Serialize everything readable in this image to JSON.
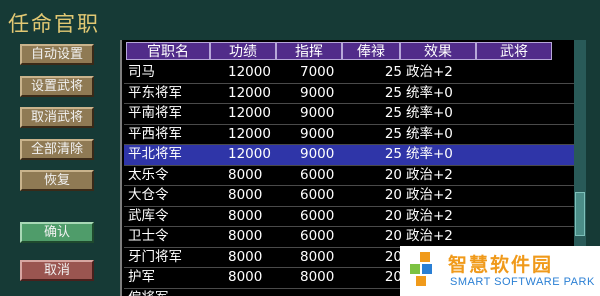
{
  "window": {
    "title": "任命官职"
  },
  "buttons": {
    "auto_set": "自动设置",
    "set_general": "设置武将",
    "cancel_general": "取消武将",
    "clear_all": "全部清除",
    "restore": "恢复",
    "confirm": "确认",
    "cancel": "取消"
  },
  "table": {
    "headers": [
      "官职名",
      "功绩",
      "指挥",
      "俸禄",
      "效果",
      "武将"
    ],
    "rows": [
      {
        "name": "司马",
        "merit": "12000",
        "command": "7000",
        "salary": "25",
        "effect": "政治+2",
        "general": "",
        "selected": false
      },
      {
        "name": "平东将军",
        "merit": "12000",
        "command": "9000",
        "salary": "25",
        "effect": "统率+0",
        "general": "",
        "selected": false
      },
      {
        "name": "平南将军",
        "merit": "12000",
        "command": "9000",
        "salary": "25",
        "effect": "统率+0",
        "general": "",
        "selected": false
      },
      {
        "name": "平西将军",
        "merit": "12000",
        "command": "9000",
        "salary": "25",
        "effect": "统率+0",
        "general": "",
        "selected": false
      },
      {
        "name": "平北将军",
        "merit": "12000",
        "command": "9000",
        "salary": "25",
        "effect": "统率+0",
        "general": "",
        "selected": true
      },
      {
        "name": "太乐令",
        "merit": "8000",
        "command": "6000",
        "salary": "20",
        "effect": "政治+2",
        "general": "",
        "selected": false
      },
      {
        "name": "大仓令",
        "merit": "8000",
        "command": "6000",
        "salary": "20",
        "effect": "政治+2",
        "general": "",
        "selected": false
      },
      {
        "name": "武库令",
        "merit": "8000",
        "command": "6000",
        "salary": "20",
        "effect": "政治+2",
        "general": "",
        "selected": false
      },
      {
        "name": "卫士令",
        "merit": "8000",
        "command": "6000",
        "salary": "20",
        "effect": "政治+2",
        "general": "",
        "selected": false
      },
      {
        "name": "牙门将军",
        "merit": "8000",
        "command": "8000",
        "salary": "20",
        "effect": "统率+0",
        "general": "",
        "selected": false
      },
      {
        "name": "护军",
        "merit": "8000",
        "command": "8000",
        "salary": "20",
        "effect": "统率+0",
        "general": "",
        "selected": false
      },
      {
        "name": "偏将军",
        "merit": "",
        "command": "",
        "salary": "",
        "effect": "",
        "general": "",
        "selected": false
      }
    ]
  },
  "watermark": {
    "name_cn": "智慧软件园",
    "name_en": "SMART SOFTWARE PARK",
    "colors": {
      "orange": "#f09a1b",
      "blue": "#2a7fd4",
      "green": "#7cc242"
    }
  },
  "colors": {
    "background": "#163a36",
    "title": "#e2c873",
    "header_bg": "#512c8a",
    "selected_row": "#2f35a8"
  }
}
